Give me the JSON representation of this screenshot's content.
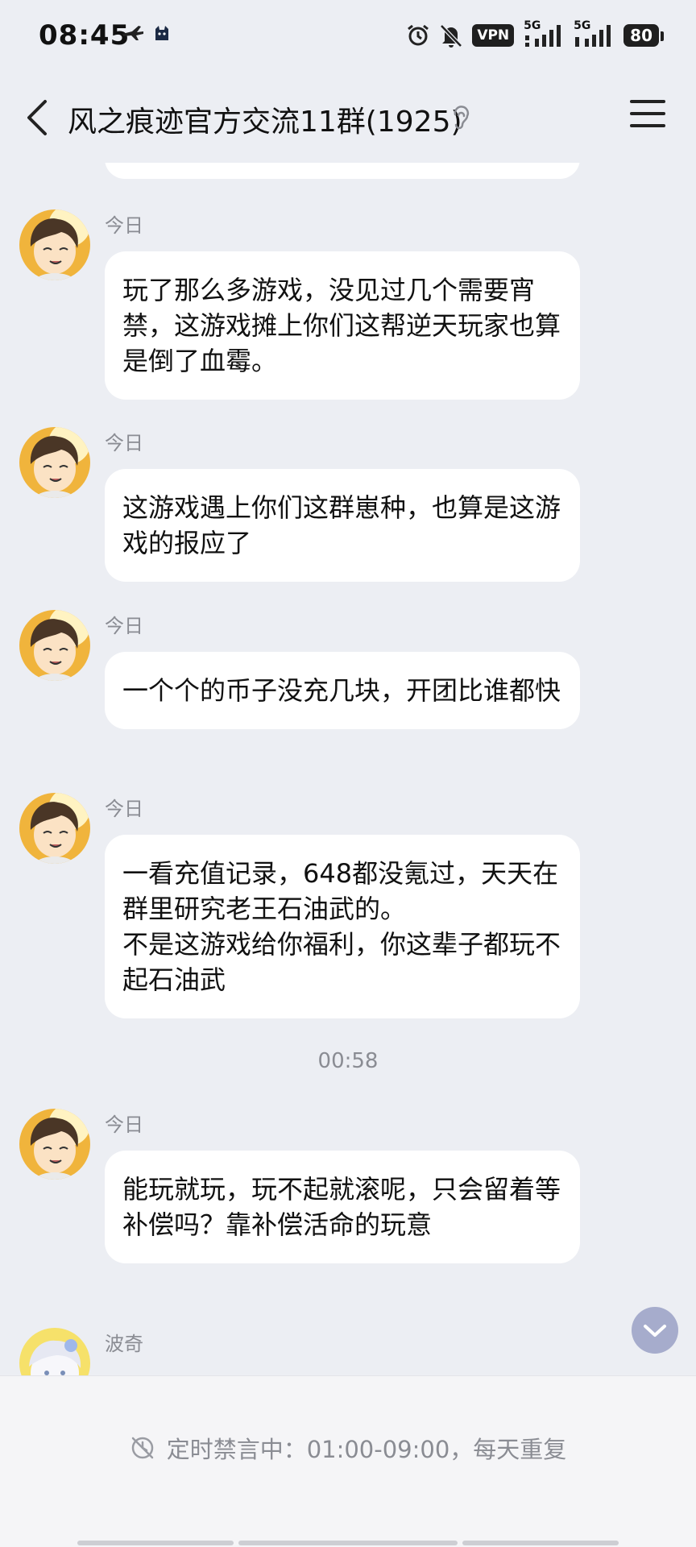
{
  "status_bar": {
    "time": "08:45",
    "vpn": "VPN",
    "net1": "5G",
    "net2": "5G",
    "battery": "80"
  },
  "header": {
    "title": "风之痕迹官方交流11群(1925)"
  },
  "messages": [
    {
      "sender": "今日",
      "text": "玩了那么多游戏，没见过几个需要宵禁，这游戏摊上你们这帮逆天玩家也算是倒了血霉。"
    },
    {
      "sender": "今日",
      "text": "这游戏遇上你们这群崽种，也算是这游戏的报应了"
    },
    {
      "sender": "今日",
      "text": "一个个的币子没充几块，开团比谁都快"
    },
    {
      "sender": "今日",
      "text": "一看充值记录，648都没氪过，天天在群里研究老王石油武的。\n不是这游戏给你福利，你这辈子都玩不起石油武"
    },
    {
      "sender": "今日",
      "text": "能玩就玩，玩不起就滚呢，只会留着等补偿吗？靠补偿活命的玩意"
    },
    {
      "sender": "波奇",
      "text": ""
    }
  ],
  "time_divider": "00:58",
  "bottom": {
    "mute_notice": "定时禁言中：01:00-09:00，每天重复"
  },
  "icons": {
    "back": "chevron-left-icon",
    "menu": "hamburger-menu-icon",
    "ear": "ear-icon",
    "scroll_down": "chevron-down-icon",
    "mute": "mute-clock-icon"
  },
  "colors": {
    "background": "#eceef3",
    "bubble": "#ffffff",
    "meta_text": "#8a8c93",
    "scroll_button": "#a6accc"
  }
}
